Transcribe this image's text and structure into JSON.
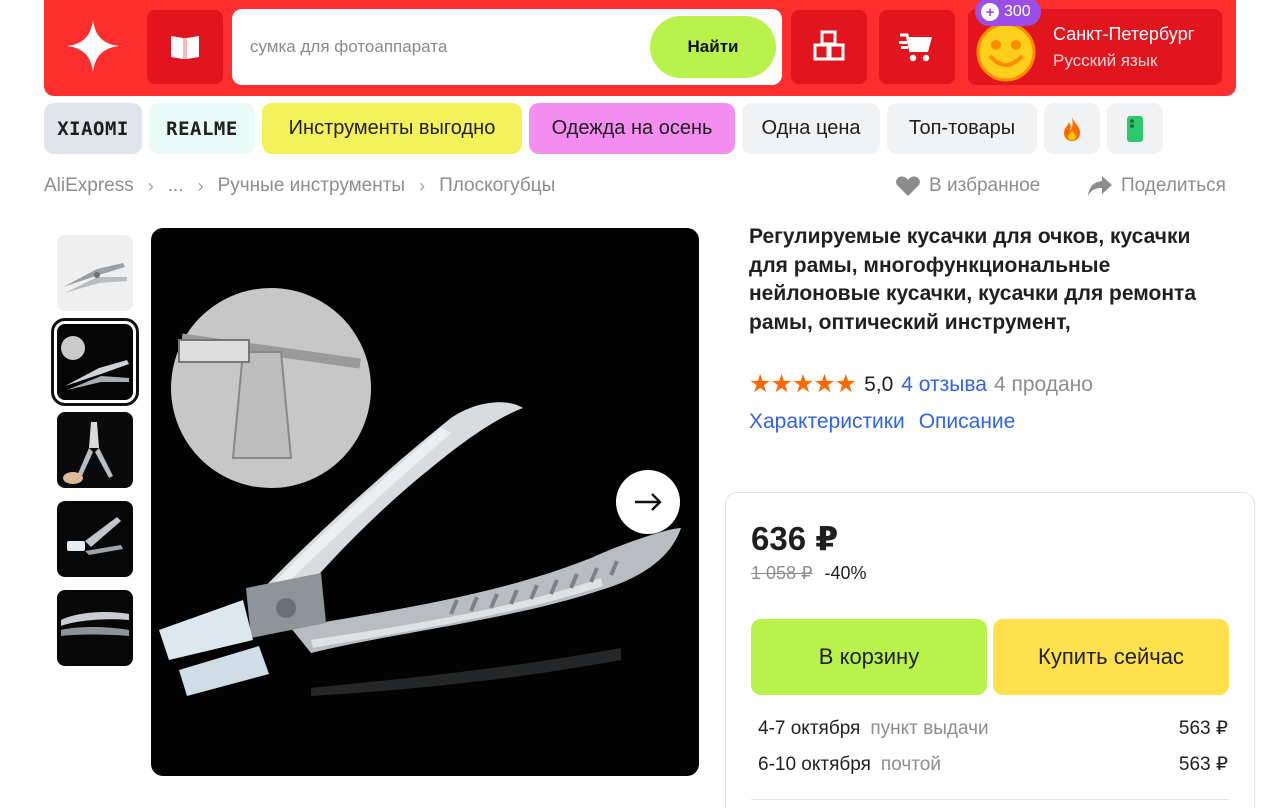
{
  "header": {
    "search_placeholder": "сумка для фотоаппарата",
    "search_button": "Найти",
    "points": "300",
    "city": "Санкт-Петербург",
    "language": "Русский язык",
    "icons": [
      "aliexpress-star-logo",
      "catalog-book-icon",
      "cube-boxes-icon",
      "cart-fast-icon",
      "smiley-avatar-icon"
    ]
  },
  "chips": [
    {
      "label": "XIAOMI",
      "bg": "#dfe4ea"
    },
    {
      "label": "REALME",
      "bg": "#e8fbf7"
    },
    {
      "label": "Инструменты выгодно",
      "bg": "#f4f25a"
    },
    {
      "label": "Одежда на осень",
      "bg": "#f38df0"
    },
    {
      "label": "Одна цена",
      "bg": "#f1f2f4"
    },
    {
      "label": "Топ-товары",
      "bg": "#f1f2f4"
    }
  ],
  "chip_icons": [
    "fire-icon",
    "phone-icon"
  ],
  "breadcrumb": [
    "AliExpress",
    "...",
    "Ручные инструменты",
    "Плоскогубцы"
  ],
  "actions": {
    "favorite": "В избранное",
    "share": "Поделиться"
  },
  "product": {
    "title": "Регулируемые кусачки для очков, кусачки для рамы, многофункциональные нейлоновые кусачки, кусачки для ремонта рамы, оптический инструмент,",
    "stars": "★★★★★",
    "rating": "5,0",
    "reviews": "4 отзыва",
    "sold": "4 продано",
    "tabs": [
      "Характеристики",
      "Описание"
    ]
  },
  "purchase": {
    "price": "636 ₽",
    "old_price": "1 058 ₽",
    "discount": "-40%",
    "cart_button": "В корзину",
    "buy_button": "Купить сейчас",
    "delivery": [
      {
        "date": "4-7 октября",
        "method": "пункт выдачи",
        "price": "563 ₽"
      },
      {
        "date": "6-10 октября",
        "method": "почтой",
        "price": "563 ₽"
      }
    ]
  },
  "colors": {
    "header_red": "#ff2e2e",
    "header_dark_red": "#e2141d",
    "accent_green": "#b9f24a",
    "accent_yellow": "#ffe14d",
    "link_blue": "#2e63ec",
    "star_orange": "#ff6a00",
    "points_purple": "#9b4de8"
  }
}
